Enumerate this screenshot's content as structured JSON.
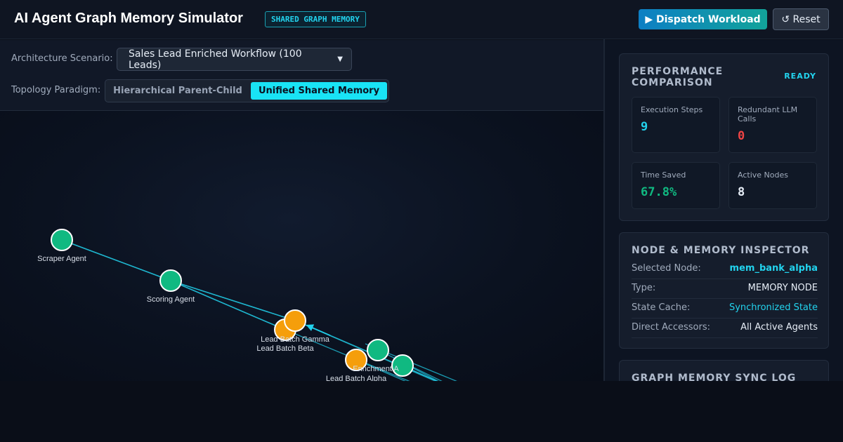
{
  "header": {
    "title": "AI Agent Graph Memory Simulator",
    "badge": "SHARED GRAPH MEMORY",
    "dispatch_label": "▶ Dispatch Workload",
    "reset_label": "↺ Reset"
  },
  "controls": {
    "scenario_label": "Architecture Scenario:",
    "scenario_value": "Sales Lead Enriched Workflow (100 Leads)",
    "topology_label": "Topology Paradigm:",
    "topology_options": [
      "Hierarchical Parent-Child",
      "Unified Shared Memory"
    ],
    "topology_selected": "Unified Shared Memory"
  },
  "graph": {
    "nodes": [
      {
        "id": "scraper",
        "label": "Scraper Agent",
        "kind": "agent"
      },
      {
        "id": "scoring",
        "label": "Scoring Agent",
        "kind": "agent"
      },
      {
        "id": "gamma",
        "label": "Lead Batch Gamma",
        "kind": "memory"
      },
      {
        "id": "beta",
        "label": "Lead Batch Beta",
        "kind": "memory"
      },
      {
        "id": "enrichment",
        "label": "Enrichment A",
        "kind": "agent"
      },
      {
        "id": "alpha",
        "label": "Lead Batch Alpha",
        "kind": "memory"
      },
      {
        "id": "agent7",
        "label": "",
        "kind": "agent"
      }
    ],
    "colors": {
      "agent": "#10b981",
      "memory": "#f59e0b",
      "edge": "#22d3ee"
    }
  },
  "performance": {
    "title": "PERFORMANCE COMPARISON",
    "status": "READY",
    "metrics": [
      {
        "label": "Execution Steps",
        "value": "9",
        "color": "#22d3ee"
      },
      {
        "label": "Redundant LLM Calls",
        "value": "0",
        "color": "#ef4444"
      },
      {
        "label": "Time Saved",
        "value": "67.8%",
        "color": "#10b981"
      },
      {
        "label": "Active Nodes",
        "value": "8",
        "color": "#e6edf6"
      }
    ]
  },
  "inspector": {
    "title": "NODE & MEMORY INSPECTOR",
    "rows": [
      {
        "key": "Selected Node:",
        "value": "mem_bank_alpha",
        "color": "#22d3ee"
      },
      {
        "key": "Type:",
        "value": "MEMORY NODE",
        "color": "#e6edf6"
      },
      {
        "key": "State Cache:",
        "value": "Synchronized State",
        "color": "#22d3ee"
      },
      {
        "key": "Direct Accessors:",
        "value": "All Active Agents",
        "color": "#e6edf6"
      }
    ]
  },
  "sync_log": {
    "title": "GRAPH MEMORY SYNC LOG"
  }
}
